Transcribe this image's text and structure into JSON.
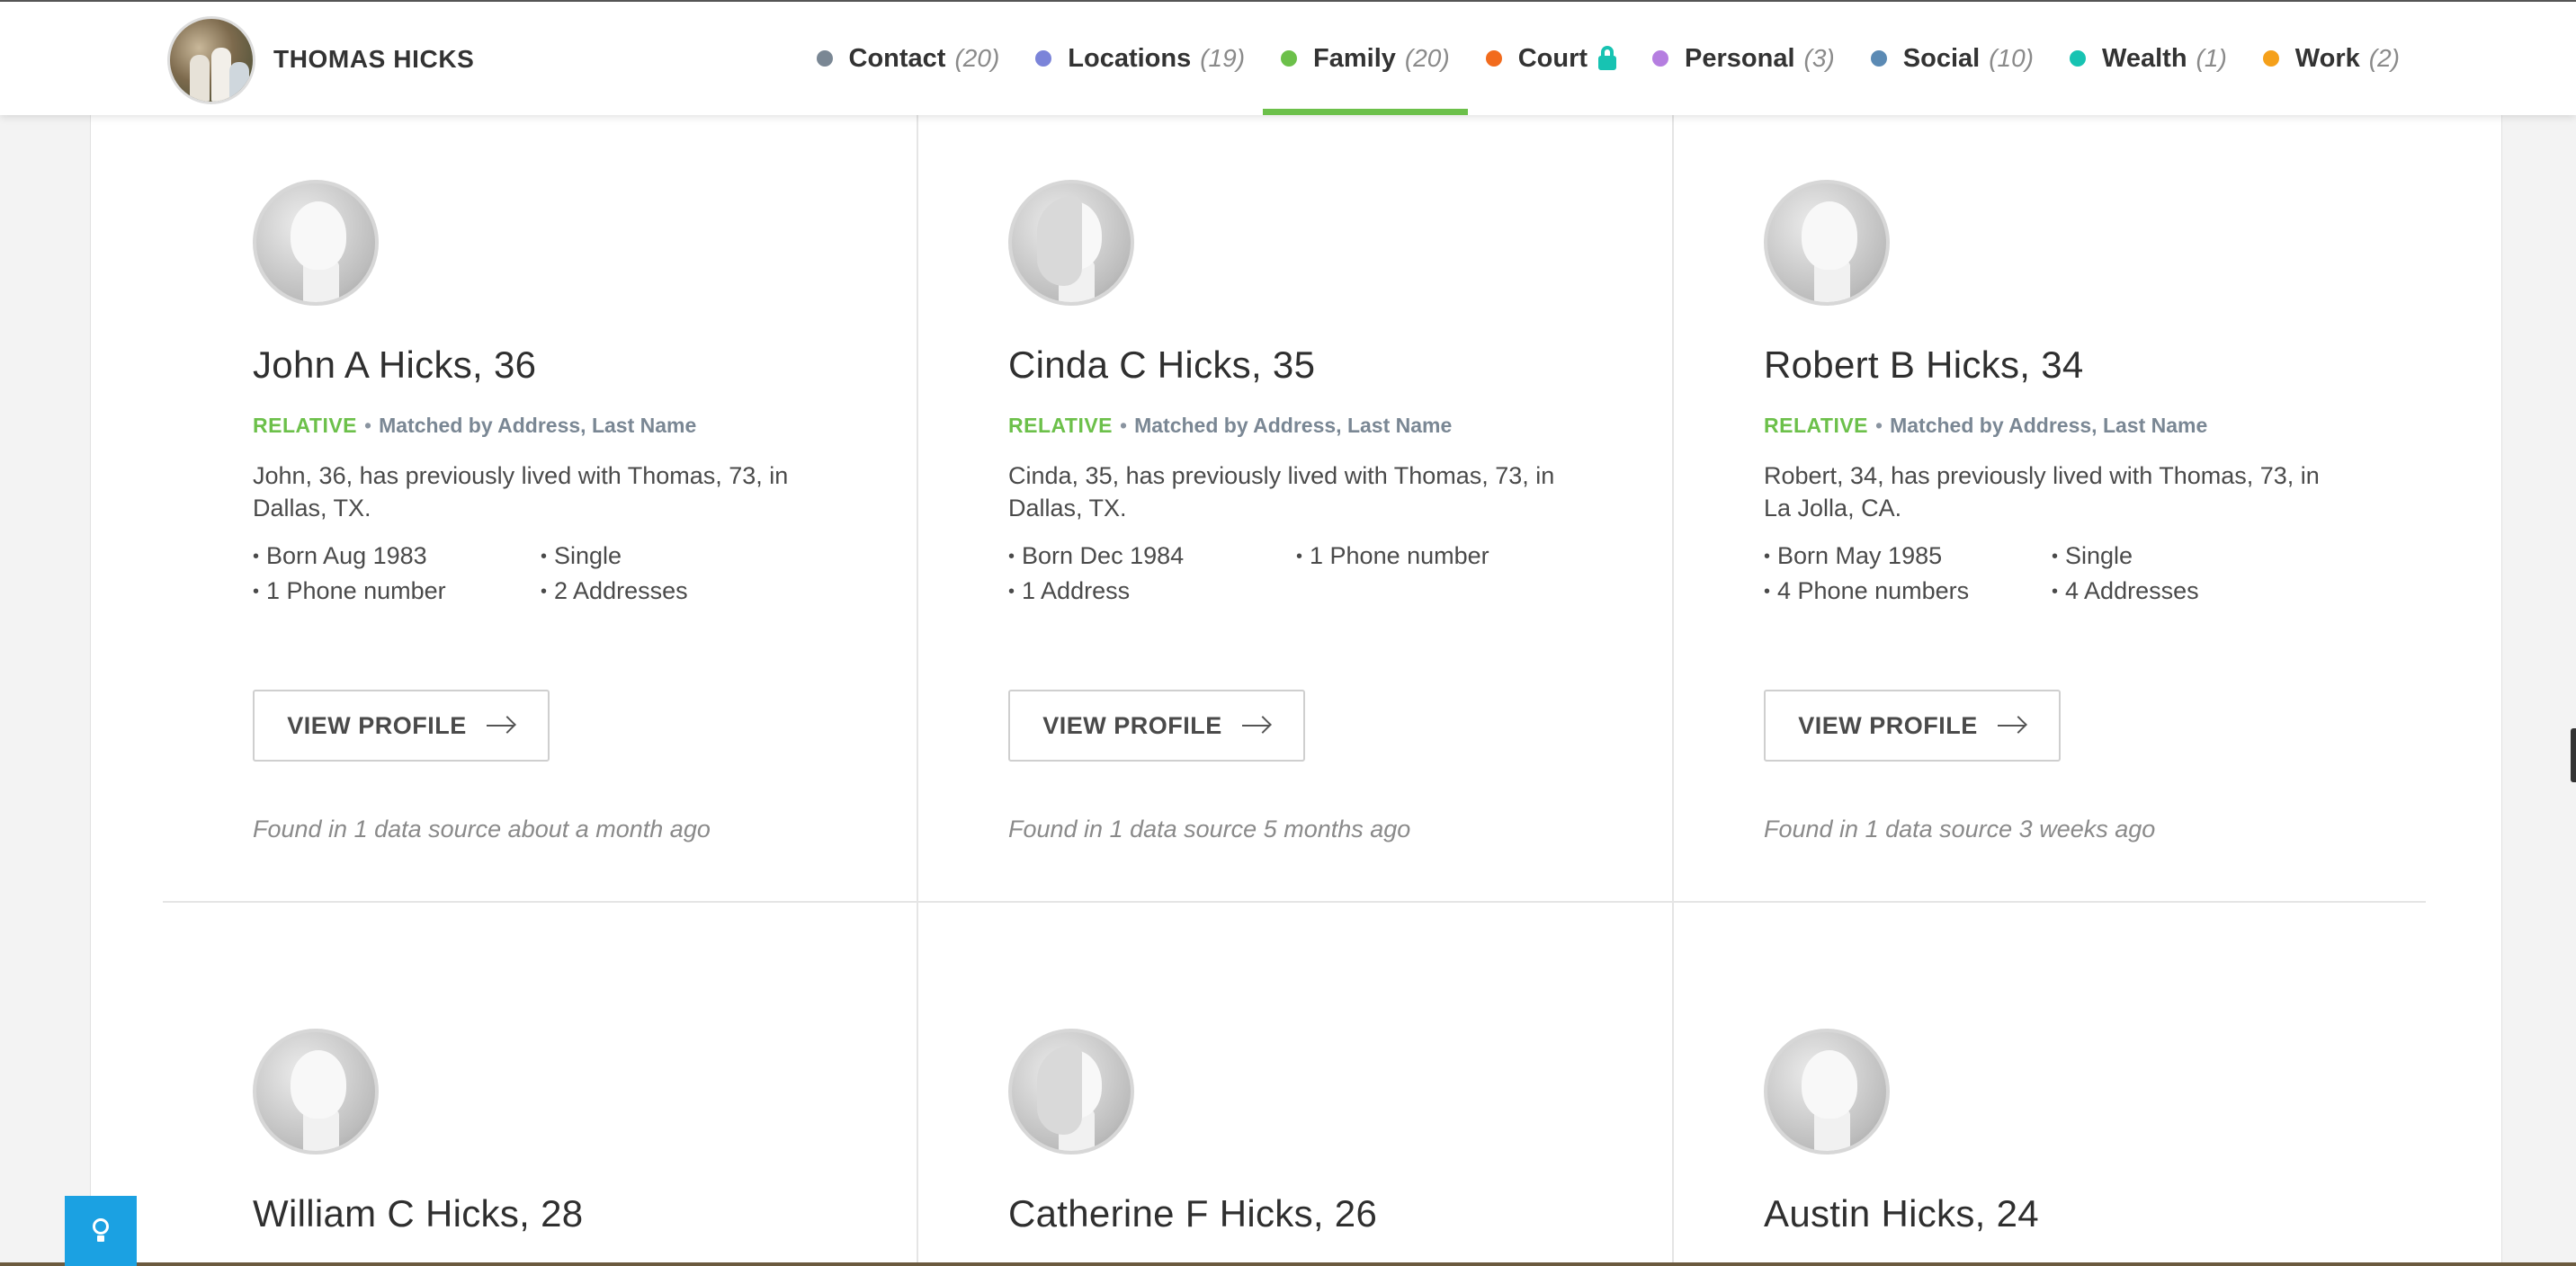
{
  "header": {
    "name": "THOMAS HICKS",
    "nav": [
      {
        "label": "Contact",
        "count": "(20)",
        "color": "#7a8794"
      },
      {
        "label": "Locations",
        "count": "(19)",
        "color": "#7b84d9"
      },
      {
        "label": "Family",
        "count": "(20)",
        "color": "#6cc04a"
      },
      {
        "label": "Court",
        "count": "",
        "color": "#f26b1d"
      },
      {
        "label": "Personal",
        "count": "(3)",
        "color": "#b57ee0"
      },
      {
        "label": "Social",
        "count": "(10)",
        "color": "#5b8ab4"
      },
      {
        "label": "Wealth",
        "count": "(1)",
        "color": "#17c3b2"
      },
      {
        "label": "Work",
        "count": "(2)",
        "color": "#f5a01a"
      }
    ]
  },
  "cards": [
    {
      "name": "John A Hicks, 36",
      "tag": "RELATIVE",
      "matched": "Matched by Address, Last Name",
      "desc": "John, 36, has previously lived with Thomas, 73, in Dallas, TX.",
      "facts": [
        "Born Aug 1983",
        "Single",
        "1 Phone number",
        "2 Addresses"
      ],
      "button": "VIEW PROFILE",
      "found": "Found in 1 data source about a month ago"
    },
    {
      "name": "Cinda C Hicks, 35",
      "tag": "RELATIVE",
      "matched": "Matched by Address, Last Name",
      "desc": "Cinda, 35, has previously lived with Thomas, 73, in Dallas, TX.",
      "facts": [
        "Born Dec 1984",
        "1 Phone number",
        "1 Address"
      ],
      "button": "VIEW PROFILE",
      "found": "Found in 1 data source 5 months ago"
    },
    {
      "name": "Robert B Hicks, 34",
      "tag": "RELATIVE",
      "matched": "Matched by Address, Last Name",
      "desc": "Robert, 34, has previously lived with Thomas, 73, in La Jolla, CA.",
      "facts": [
        "Born May 1985",
        "Single",
        "4 Phone numbers",
        "4 Addresses"
      ],
      "button": "VIEW PROFILE",
      "found": "Found in 1 data source 3 weeks ago"
    },
    {
      "name": "William C Hicks, 28"
    },
    {
      "name": "Catherine F Hicks, 26"
    },
    {
      "name": "Austin Hicks, 24"
    }
  ]
}
